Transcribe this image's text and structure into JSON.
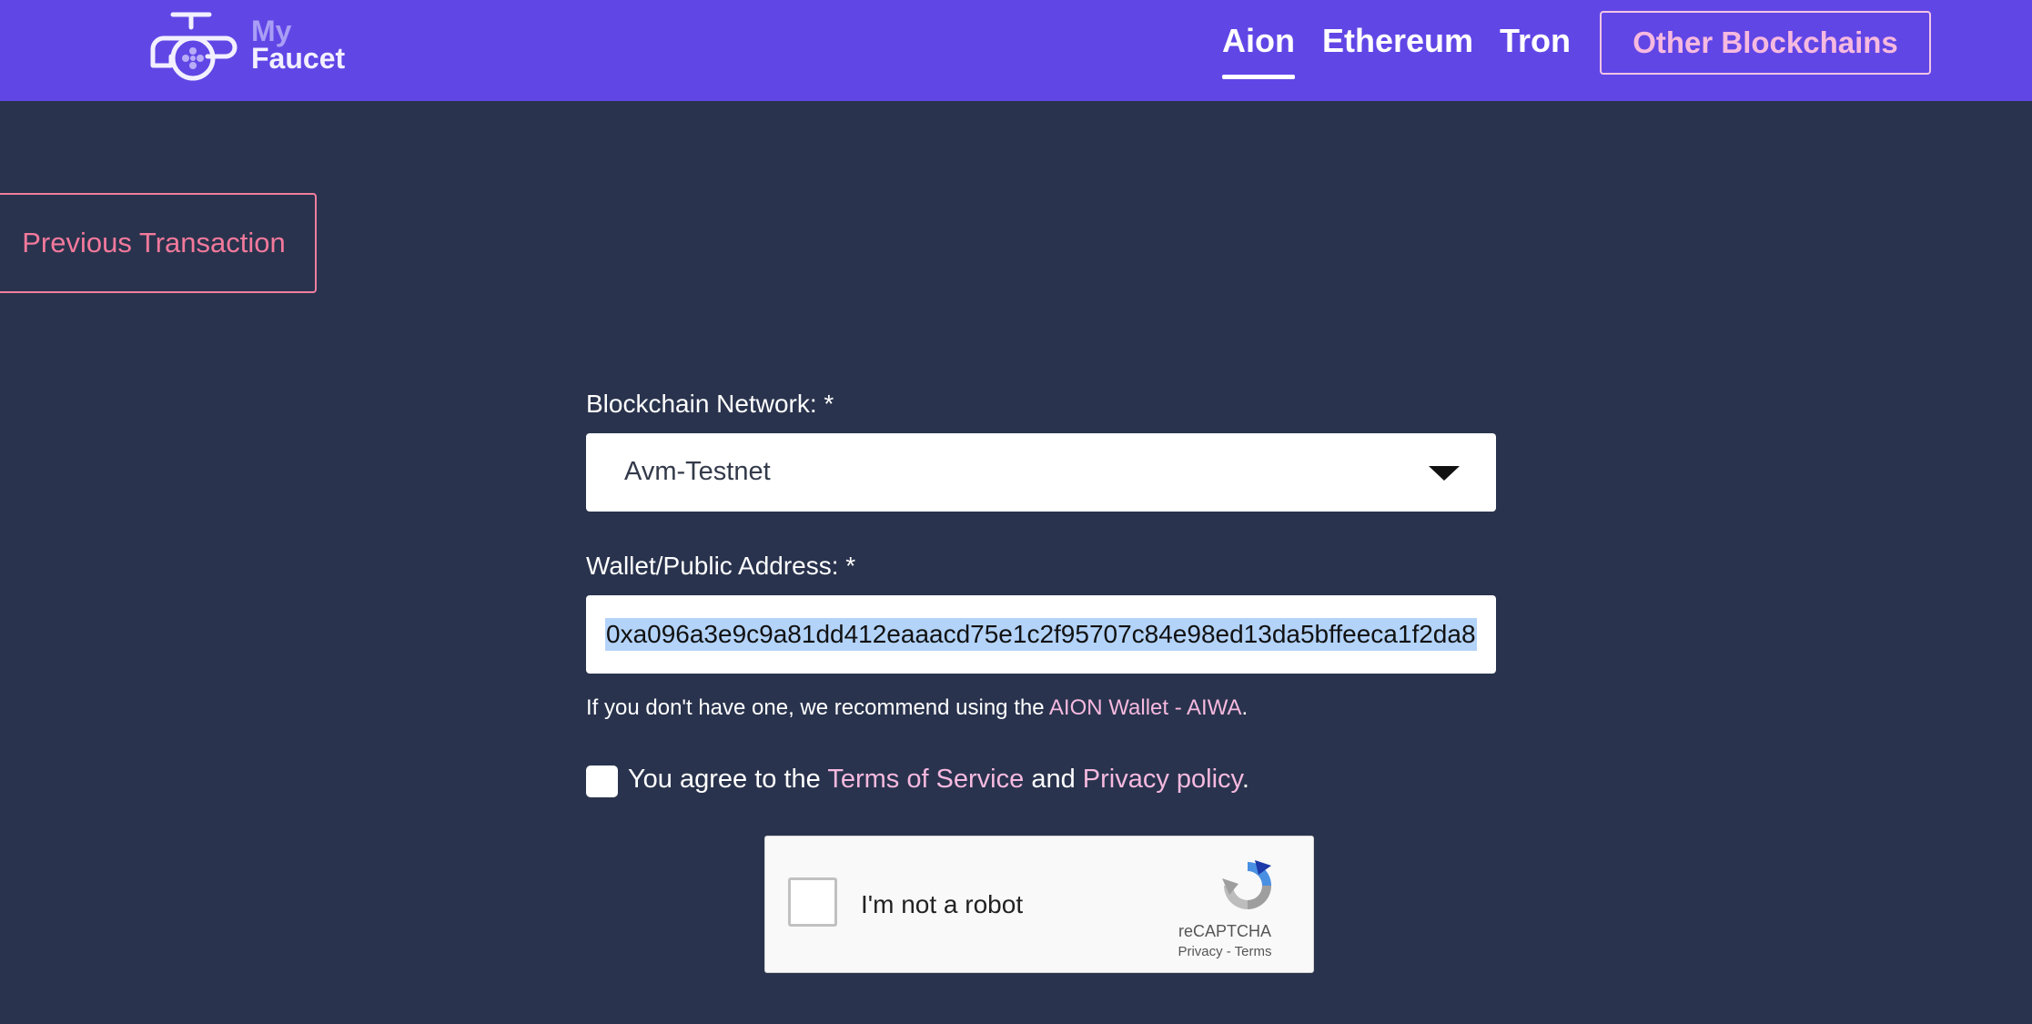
{
  "header": {
    "logo": {
      "line1": "My",
      "line2": "Faucet",
      "icon": "faucet-icon"
    },
    "nav": [
      {
        "label": "Aion",
        "active": true
      },
      {
        "label": "Ethereum",
        "active": false
      },
      {
        "label": "Tron",
        "active": false
      }
    ],
    "other_button": "Other Blockchains"
  },
  "previous_transaction": "Previous Transaction",
  "form": {
    "network_label": "Blockchain Network: *",
    "network_value": "Avm-Testnet",
    "wallet_label": "Wallet/Public Address: *",
    "wallet_value": "0xa096a3e9c9a81dd412eaaacd75e1c2f95707c84e98ed13da5bffeeca1f2da8",
    "hint_prefix": "If you don't have one, we recommend using the ",
    "hint_link": "AION Wallet - AIWA",
    "hint_suffix": ".",
    "agree_prefix": "You agree to the ",
    "terms_link": "Terms of Service",
    "agree_and": " and ",
    "privacy_link": "Privacy policy",
    "agree_suffix": "."
  },
  "recaptcha": {
    "label": "I'm not a robot",
    "brand": "reCAPTCHA",
    "links": "Privacy - Terms",
    "icon": "recaptcha-icon"
  },
  "colors": {
    "header_bg": "#6146e6",
    "page_bg": "#29334d",
    "accent_pink": "#f6b9df",
    "prev_button": "#f3799c",
    "selection": "#b3d3f9"
  }
}
